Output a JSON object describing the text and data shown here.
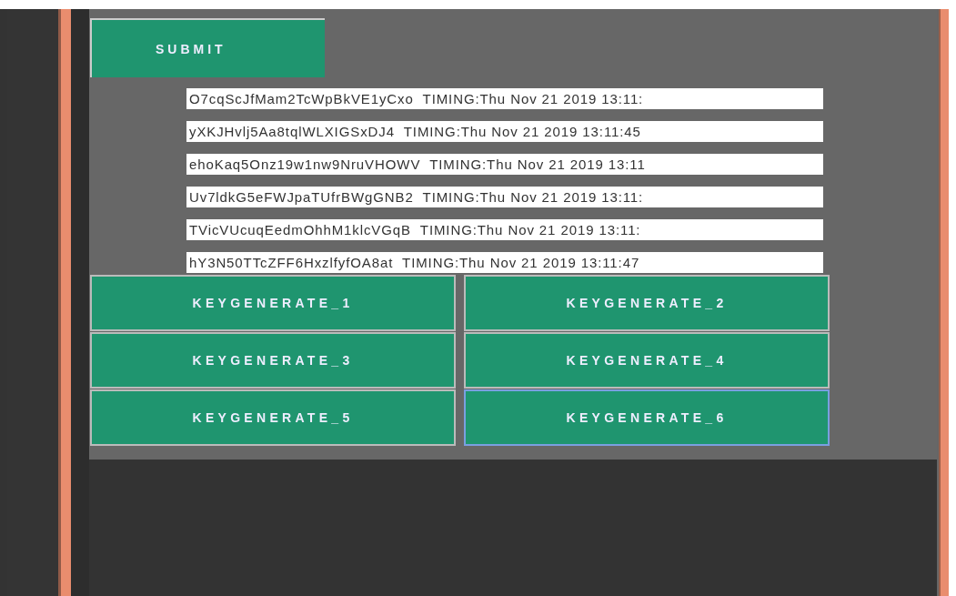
{
  "submit_button": {
    "label": "SUBMIT"
  },
  "keys": [
    {
      "text": "O7cqScJfMam2TcWpBkVE1yCxo  TIMING:Thu Nov 21 2019 13:11:"
    },
    {
      "text": "yXKJHvlj5Aa8tqlWLXIGSxDJ4  TIMING:Thu Nov 21 2019 13:11:45"
    },
    {
      "text": "ehoKaq5Onz19w1nw9NruVHOWV  TIMING:Thu Nov 21 2019 13:11"
    },
    {
      "text": "Uv7ldkG5eFWJpaTUfrBWgGNB2  TIMING:Thu Nov 21 2019 13:11:"
    },
    {
      "text": "TVicVUcuqEedmOhhM1klcVGqB  TIMING:Thu Nov 21 2019 13:11:"
    },
    {
      "text": "hY3N50TTcZFF6HxzlfyfOA8at  TIMING:Thu Nov 21 2019 13:11:47"
    }
  ],
  "generate_buttons": [
    {
      "label": "KEYGENERATE_1",
      "focused": false
    },
    {
      "label": "KEYGENERATE_2",
      "focused": false
    },
    {
      "label": "KEYGENERATE_3",
      "focused": false
    },
    {
      "label": "KEYGENERATE_4",
      "focused": false
    },
    {
      "label": "KEYGENERATE_5",
      "focused": false
    },
    {
      "label": "KEYGENERATE_6",
      "focused": true
    }
  ]
}
